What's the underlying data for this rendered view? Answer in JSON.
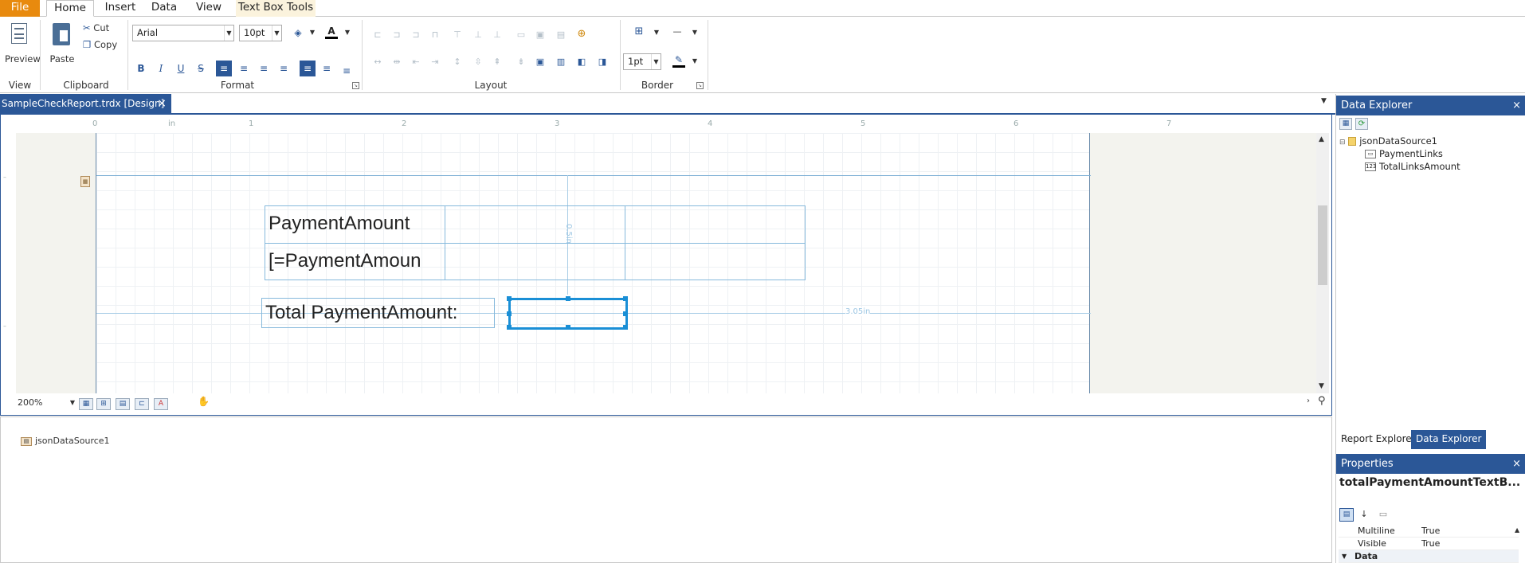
{
  "ribbon_tabs": {
    "file": "File",
    "home": "Home",
    "insert": "Insert",
    "data": "Data",
    "view": "View",
    "textbox_tools": "Text Box Tools"
  },
  "ribbon": {
    "preview": "Preview",
    "paste": "Paste",
    "cut": "Cut",
    "copy": "Copy",
    "font_name": "Arial",
    "font_size": "10pt",
    "border_width": "1pt",
    "groups": {
      "view": "View",
      "clipboard": "Clipboard",
      "format": "Format",
      "layout": "Layout",
      "border": "Border"
    },
    "bold": "B",
    "italic": "I",
    "underline": "U",
    "strike": "S"
  },
  "document_tab": {
    "title": "SampleCheckReport.trdx [Design]",
    "close": "×"
  },
  "ruler": {
    "unit": "in",
    "marks": [
      "0",
      "1",
      "2",
      "3",
      "4",
      "5",
      "6",
      "7"
    ]
  },
  "design": {
    "header_cell": "PaymentAmount",
    "detail_cell": "[=PaymentAmoun",
    "total_label": "Total PaymentAmount:",
    "vertical_dim": "0.5in",
    "horizontal_dim": "3.05in"
  },
  "zoom": "200%",
  "tray": {
    "component": "jsonDataSource1"
  },
  "data_explorer": {
    "title": "Data Explorer",
    "root": "jsonDataSource1",
    "fields": [
      "PaymentLinks",
      "TotalLinksAmount"
    ]
  },
  "explorer_tabs": {
    "report": "Report Explorer",
    "data": "Data Explorer"
  },
  "properties": {
    "title": "Properties",
    "selected": "totalPaymentAmountTextB...",
    "rows": [
      {
        "name": "Multiline",
        "value": "True"
      },
      {
        "name": "Visible",
        "value": "True"
      }
    ],
    "category": "Data"
  },
  "colors": {
    "accent": "#2b5797",
    "file_tab": "#e88a0e",
    "selection": "#1a8fd6"
  }
}
